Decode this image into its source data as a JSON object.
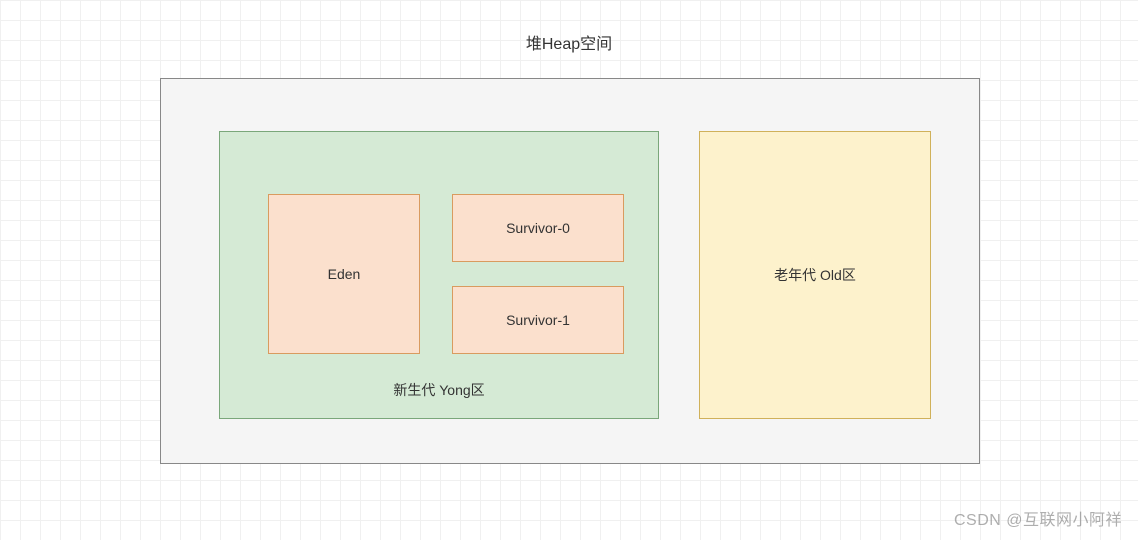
{
  "title": "堆Heap空间",
  "young": {
    "label": "新生代 Yong区",
    "eden": "Eden",
    "survivor0": "Survivor-0",
    "survivor1": "Survivor-1"
  },
  "old": {
    "label": "老年代 Old区"
  },
  "watermark": "CSDN @互联网小阿祥"
}
